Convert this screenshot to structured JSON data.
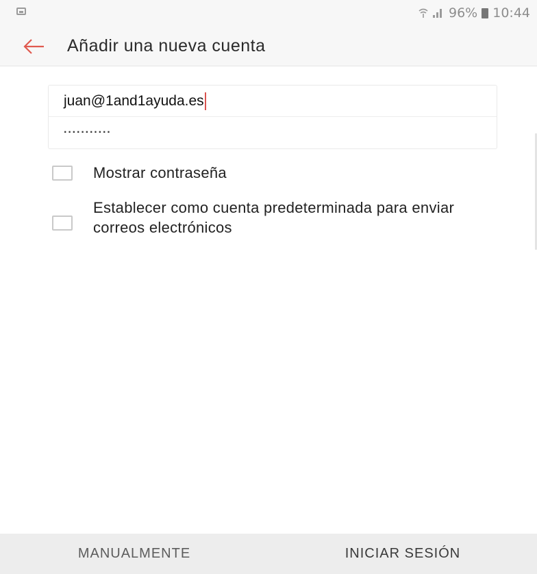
{
  "status_bar": {
    "notification_icon": "image-notification-icon",
    "battery": "96%",
    "time": "10:44"
  },
  "app_bar": {
    "back_icon": "arrow-left-icon",
    "title": "Añadir una nueva cuenta",
    "accent_color": "#e05a4f"
  },
  "form": {
    "email_value": "juan@1and1ayuda.es",
    "password_masked": "···········"
  },
  "options": {
    "show_password_label": "Mostrar contraseña",
    "show_password_checked": false,
    "default_account_label": "Establecer como cuenta predeterminada para enviar correos electrónicos",
    "default_account_checked": false
  },
  "footer": {
    "manual_label": "MANUALMENTE",
    "login_label": "INICIAR SESIÓN"
  }
}
